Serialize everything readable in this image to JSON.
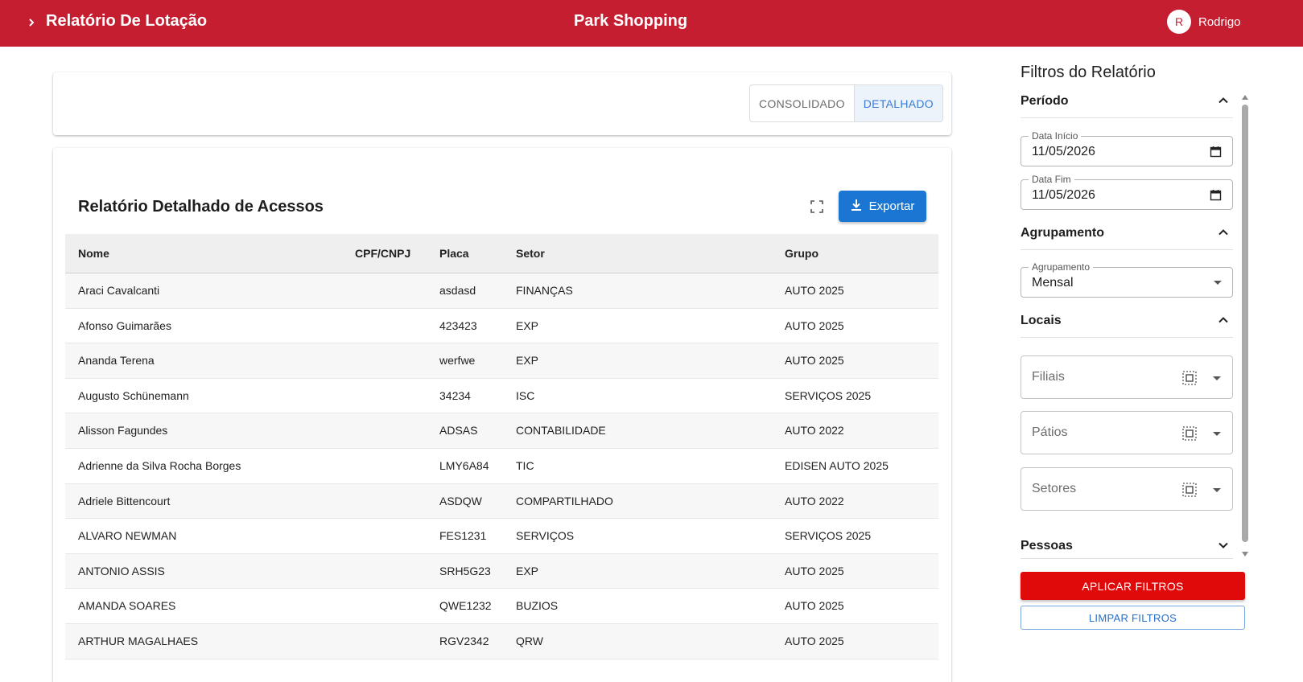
{
  "header": {
    "title": "Relatório De Lotação",
    "store": "Park Shopping",
    "user_initial": "R",
    "user_name": "Rodrigo",
    "color": "#c41e30"
  },
  "view_toggle": {
    "options": [
      "CONSOLIDADO",
      "DETALHADO"
    ],
    "selected": "DETALHADO"
  },
  "report": {
    "title": "Relatório Detalhado de Acessos",
    "export_label": "Exportar",
    "columns": [
      "Nome",
      "CPF/CNPJ",
      "Placa",
      "Setor",
      "Grupo"
    ],
    "rows": [
      [
        "Araci Cavalcanti",
        "",
        "asdasd",
        "FINANÇAS",
        "AUTO 2025"
      ],
      [
        "Afonso Guimarães",
        "",
        "423423",
        "EXP",
        "AUTO 2025"
      ],
      [
        "Ananda Terena",
        "",
        "werfwe",
        "EXP",
        "AUTO 2025"
      ],
      [
        "Augusto Schünemann",
        "",
        "34234",
        "ISC",
        "SERVIÇOS 2025"
      ],
      [
        "Alisson Fagundes",
        "",
        "ADSAS",
        "CONTABILIDADE",
        "AUTO 2022"
      ],
      [
        "Adrienne da Silva Rocha Borges",
        "",
        "LMY6A84",
        "TIC",
        "EDISEN AUTO 2025"
      ],
      [
        "Adriele Bittencourt",
        "",
        "ASDQW",
        "COMPARTILHADO",
        "AUTO 2022"
      ],
      [
        "ALVARO NEWMAN",
        "",
        "FES1231",
        "SERVIÇOS",
        "SERVIÇOS 2025"
      ],
      [
        "ANTONIO ASSIS",
        "",
        "SRH5G23",
        "EXP",
        "AUTO 2025"
      ],
      [
        "AMANDA SOARES",
        "",
        "QWE1232",
        "BUZIOS",
        "AUTO 2025"
      ],
      [
        "ARTHUR MAGALHAES",
        "",
        "RGV2342",
        "QRW",
        "AUTO 2025"
      ]
    ]
  },
  "filters": {
    "title": "Filtros do Relatório",
    "periodo": {
      "label": "Período",
      "start_label": "Data Início",
      "start_value": "11/05/2026",
      "end_label": "Data Fim",
      "end_value": "11/05/2026"
    },
    "agrupamento": {
      "label": "Agrupamento",
      "field_label": "Agrupamento",
      "value": "Mensal"
    },
    "locais": {
      "label": "Locais",
      "filiais": "Filiais",
      "patios": "Pátios",
      "setores": "Setores"
    },
    "pessoas": {
      "label": "Pessoas"
    },
    "apply_label": "APLICAR FILTROS",
    "clear_label": "LIMPAR FILTROS"
  }
}
